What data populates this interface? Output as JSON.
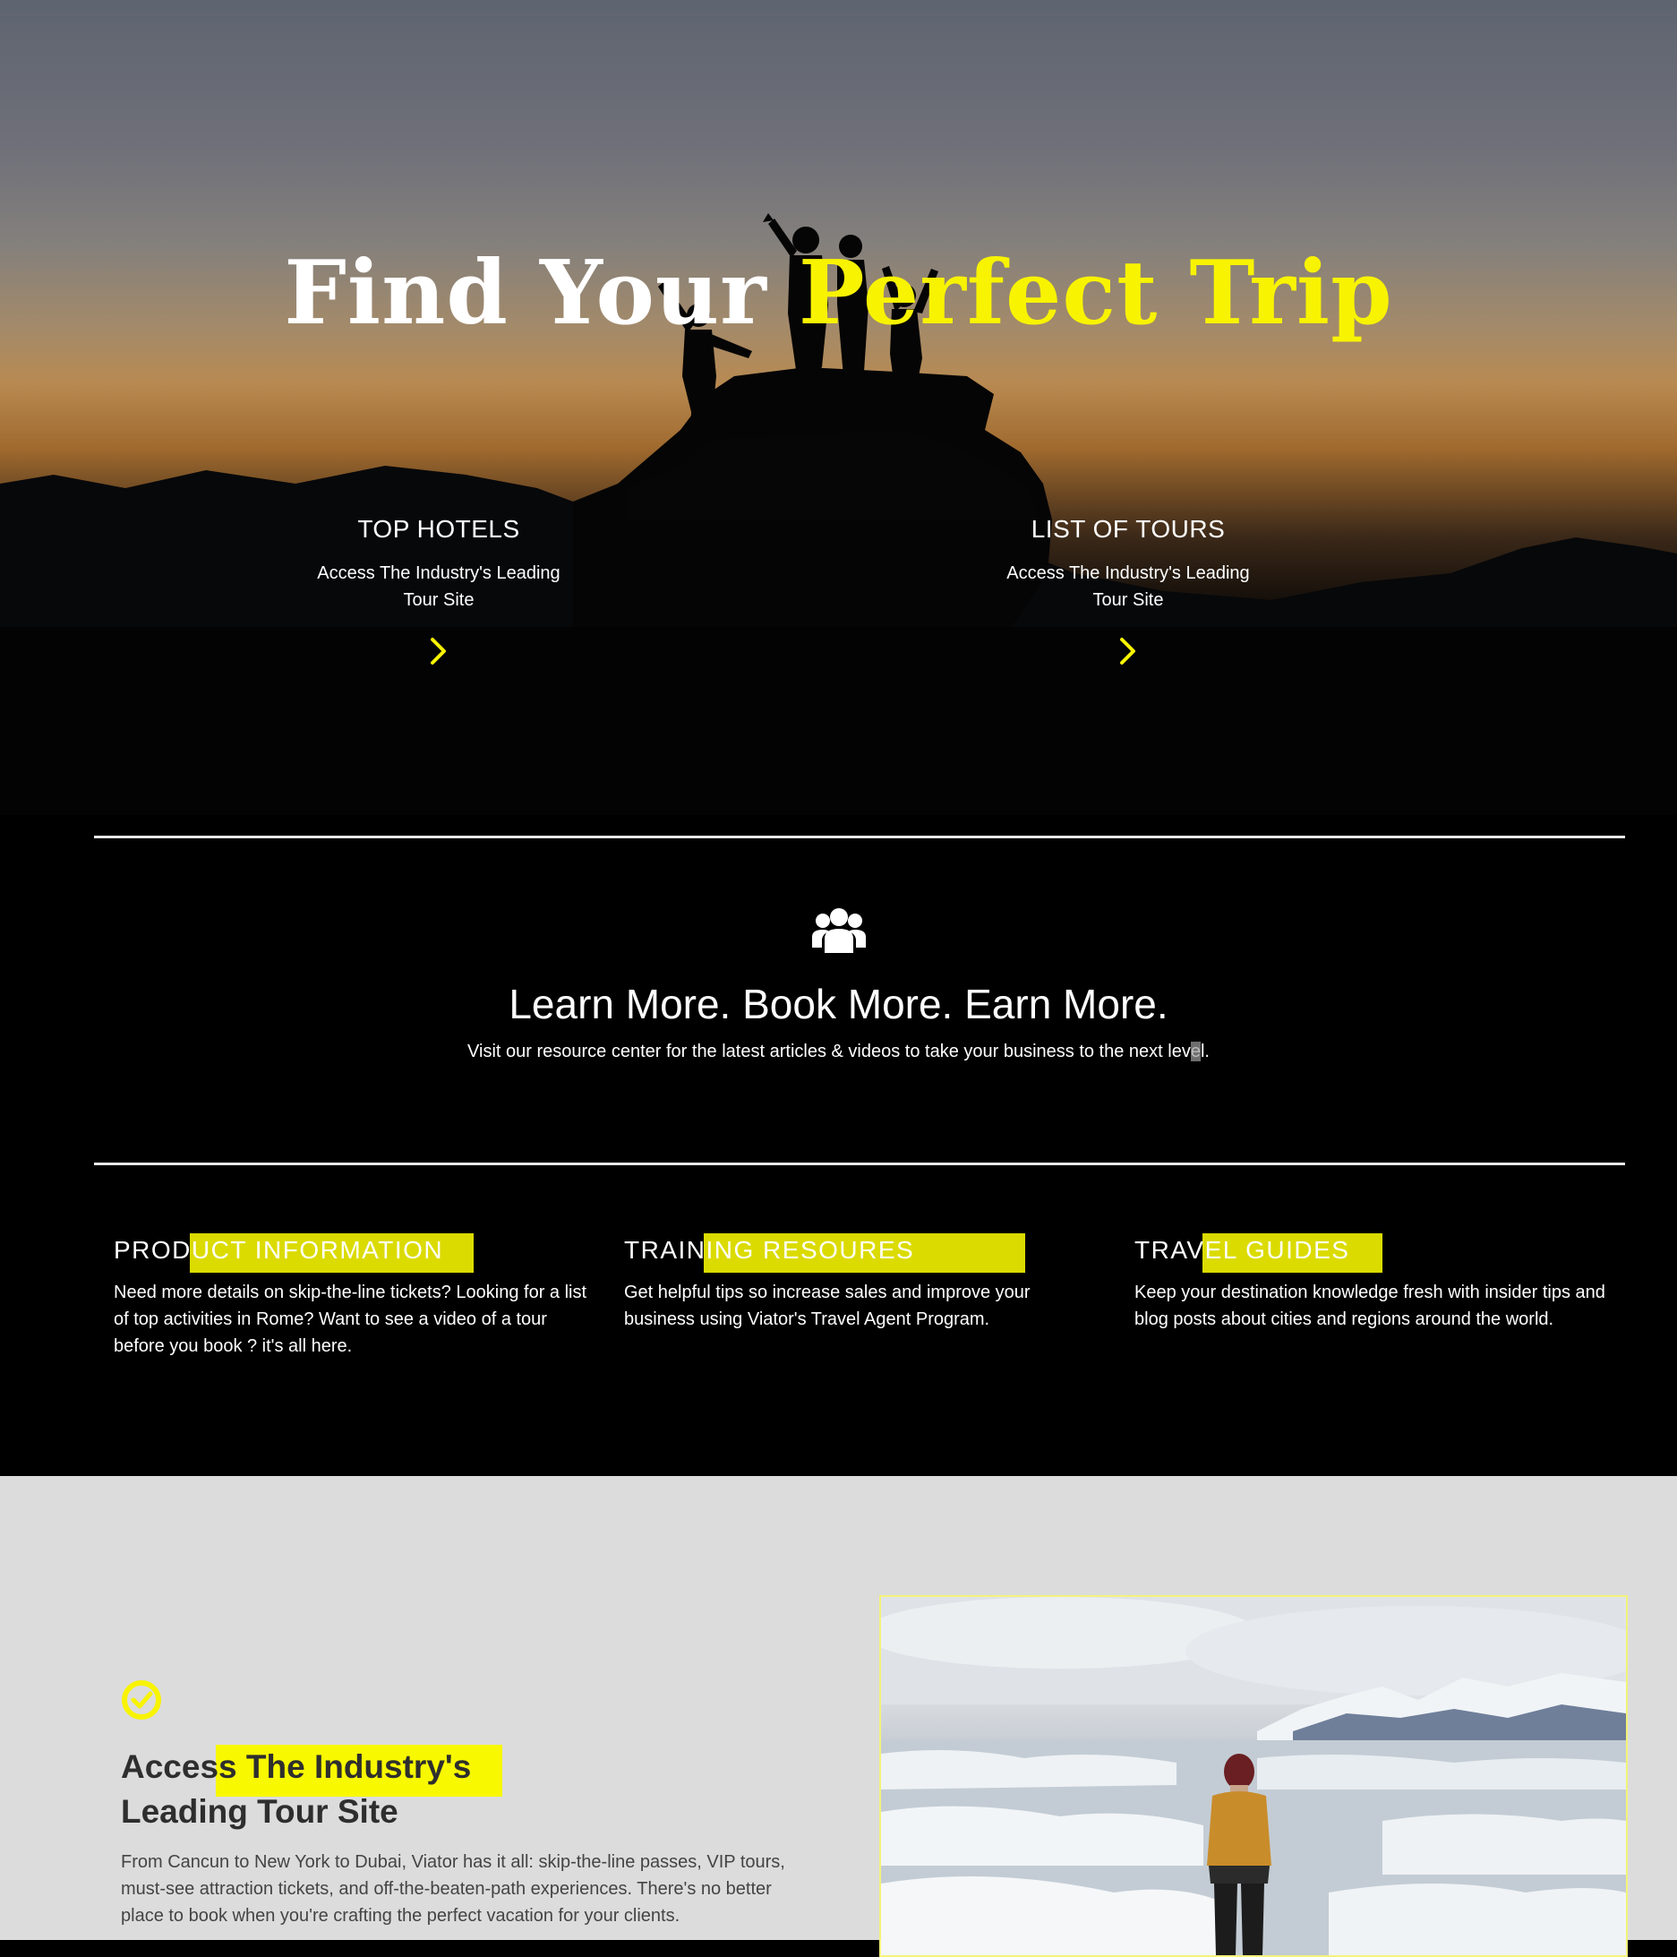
{
  "hero": {
    "title_white": "Find Your ",
    "title_yellow": "Perfect Trip",
    "cards": [
      {
        "title": "TOP HOTELS",
        "text": "Access The Industry's Leading Tour Site",
        "icon": "chevron-right-icon"
      },
      {
        "title": "LIST OF TOURS",
        "text": "Access The Industry's Leading Tour Site",
        "icon": "chevron-right-icon"
      }
    ]
  },
  "learn": {
    "icon": "users-icon",
    "heading": "Learn More. Book More. Earn More.",
    "text_before": "Visit our resource center for the latest articles & videos to take your business to the next lev",
    "text_cursor": "e",
    "text_after": "l."
  },
  "resources": [
    {
      "title": "PRODUCT INFORMATION",
      "text": "Need more details on skip-the-line tickets? Looking for a list of top activities in Rome? Want to see a video of a tour before you book ? it's all here."
    },
    {
      "title": "TRAINING RESOURES",
      "text": "Get helpful tips so increase sales and improve your business using Viator's Travel Agent Program."
    },
    {
      "title": "TRAVEL GUIDES",
      "text": "Keep your destination knowledge fresh with insider tips and blog posts about cities and regions around the world."
    }
  ],
  "feature": {
    "icon": "check-circle-icon",
    "title_line1": "Access The Industry's",
    "title_line2": "Leading Tour Site",
    "text": "From Cancun to New York to Dubai, Viator has it all: skip-the-line passes, VIP tours, must-see attraction tickets, and off-the-beaten-path experiences. There's no better place to book when you're crafting the perfect vacation for your clients."
  },
  "colors": {
    "accent": "#f8f300",
    "highlight": "#dbdb00",
    "dark_bg": "#000000",
    "light_bg": "#dcdcdc"
  }
}
